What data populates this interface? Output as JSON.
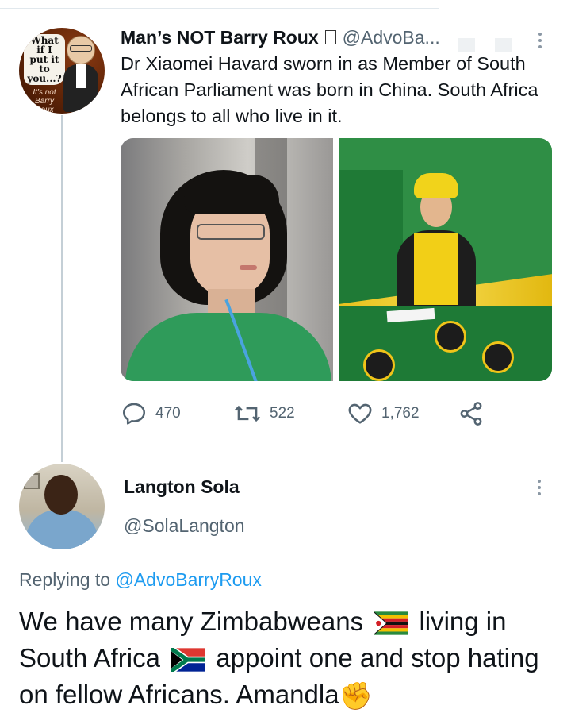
{
  "tweet": {
    "author_name": "Man’s NOT Barry Roux",
    "author_badge": "",
    "handle": "@AdvoBa...",
    "avatar_caption_top": "What if I put it to you...?",
    "avatar_caption_bottom": "It’s not Barry Roux",
    "text": "Dr Xiaomei Havard sworn in as Member of South African Parliament was born in China. South Africa belongs to all who live in it.",
    "stats": {
      "replies": "470",
      "retweets": "522",
      "likes": "1,762"
    }
  },
  "reply": {
    "author_name": "Langton Sola",
    "handle": "@SolaLangton",
    "replying_prefix": "Replying to",
    "replying_to": "@AdvoBarryRoux",
    "text_part1": "We have many Zimbabweans",
    "text_part2": "living in South Africa",
    "text_part3": "appoint one and stop hating on fellow Africans. Amandla",
    "fist_emoji": "✊"
  },
  "icons": {
    "reply": "reply-icon",
    "retweet": "retweet-icon",
    "like": "heart-icon",
    "share": "share-icon",
    "more": "more-vertical-icon"
  },
  "colors": {
    "text": "#0f1419",
    "muted": "#536471",
    "link": "#1d9bf0",
    "thread_line": "#c4cfd6"
  }
}
